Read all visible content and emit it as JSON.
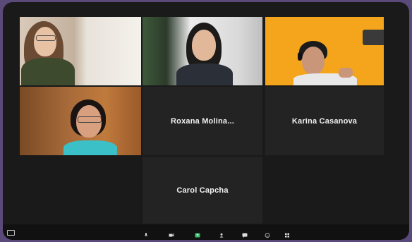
{
  "participants": [
    {
      "name": "",
      "video": true
    },
    {
      "name": "",
      "video": true
    },
    {
      "name": "",
      "video": true
    },
    {
      "name": "",
      "video": true
    },
    {
      "name": "Roxana  Molina...",
      "label": "",
      "video": false
    },
    {
      "name": "Karina Casanova",
      "label": "",
      "video": false
    },
    {
      "name": "Carol Capcha",
      "label": "",
      "video": false
    }
  ],
  "toolbar": {
    "items": [
      {
        "label": "",
        "icon": "microphone-icon"
      },
      {
        "label": "",
        "icon": "video-camera-icon"
      },
      {
        "label": "",
        "icon": "share-screen-icon"
      },
      {
        "label": "",
        "icon": "participants-icon"
      },
      {
        "label": "",
        "icon": "chat-icon"
      },
      {
        "label": "",
        "icon": "reactions-icon"
      },
      {
        "label": "",
        "icon": "apps-icon"
      }
    ]
  },
  "colors": {
    "frame": "#1a1a1a",
    "tile": "#232323",
    "active_speaker": "#8fd14f",
    "share_green": "#3ac06a",
    "outer": "#5a4a7a"
  }
}
